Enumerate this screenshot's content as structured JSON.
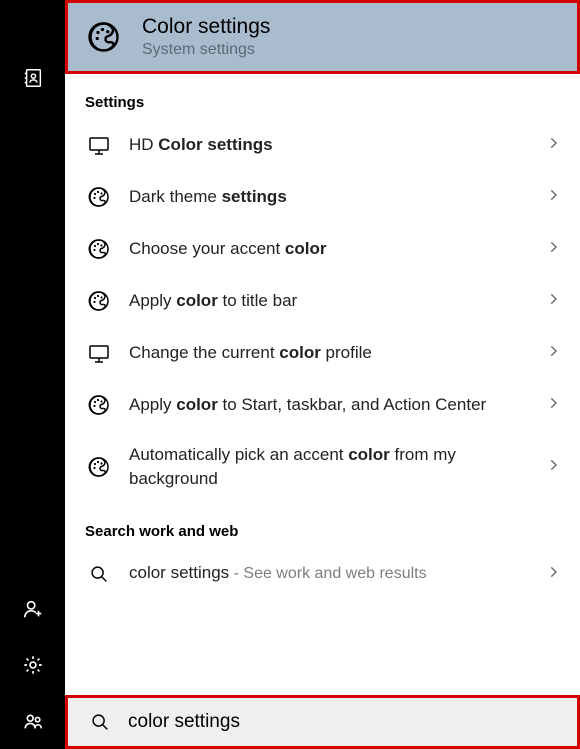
{
  "best_match": {
    "title": "Color settings",
    "subtitle": "System settings"
  },
  "section_settings": "Settings",
  "results": [
    {
      "icon": "monitor",
      "pre": "HD ",
      "bold": "Color settings",
      "post": ""
    },
    {
      "icon": "palette",
      "pre": "Dark theme ",
      "bold": "settings",
      "post": ""
    },
    {
      "icon": "palette",
      "pre": "Choose your accent ",
      "bold": "color",
      "post": ""
    },
    {
      "icon": "palette",
      "pre": "Apply ",
      "bold": "color",
      "post": " to title bar"
    },
    {
      "icon": "monitor",
      "pre": "Change the current ",
      "bold": "color",
      "post": " profile"
    },
    {
      "icon": "palette",
      "pre": "Apply ",
      "bold": "color",
      "post": " to Start, taskbar, and Action Center"
    },
    {
      "icon": "palette",
      "pre": "Automatically pick an accent ",
      "bold": "color",
      "post": " from my background"
    }
  ],
  "section_web": "Search work and web",
  "web_result": {
    "query": "color settings",
    "suffix": " - See work and web results"
  },
  "search": {
    "value": "color settings"
  }
}
